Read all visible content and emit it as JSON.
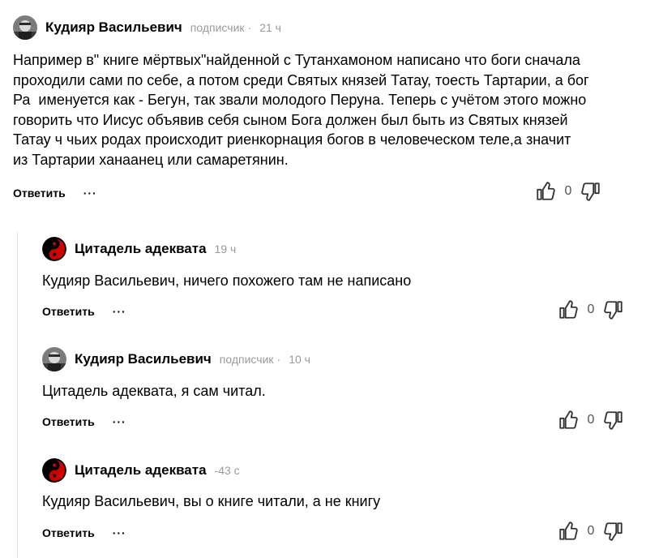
{
  "comments": [
    {
      "author": "Кудияр Васильевич",
      "badge": "подписчик",
      "dot": "·",
      "time": "21 ч",
      "text": "Например в\" книге мёртвых\"найденной с Тутанхамоном написано что боги сначала\nпроходили сами по себе, а потом среди Святых князей Татау, тоесть Тартарии, а бог\nРа  именуется как - Бегун, так звали молодого Перуна. Теперь с учётом этого можно\nговорить что Иисус объявив себя сыном Бога должен был быть из Святых князей\nТатау ч чьих родах происходит риенкорнация богов в человеческом теле,а значит\nиз Тартарии ханаанец или самаретянин.",
      "reply_label": "Ответить",
      "more_label": "···",
      "score": "0"
    },
    {
      "author": "Цитадель адеквата",
      "time": "19 ч",
      "text": "Кудияр Васильевич, ничего похожего там не написано",
      "reply_label": "Ответить",
      "more_label": "···",
      "score": "0"
    },
    {
      "author": "Кудияр Васильевич",
      "badge": "подписчик",
      "dot": "·",
      "time": "10 ч",
      "text": "Цитадель адеквата, я сам читал.",
      "reply_label": "Ответить",
      "more_label": "···",
      "score": "0"
    },
    {
      "author": "Цитадель адеквата",
      "time": "-43 с",
      "text": "Кудияр Васильевич, вы о книге читали, а не книгу",
      "reply_label": "Ответить",
      "more_label": "···",
      "score": "0"
    }
  ],
  "icons": {
    "like": "thumbs-up-icon",
    "dislike": "thumbs-down-icon",
    "avatar_kudiyar": "user-photo-avatar",
    "avatar_citadel": "yin-yang-avatar"
  },
  "colors": {
    "meta": "#9a9a9a",
    "thread_line": "#e2e2e2",
    "yin_yang_red": "#d00000"
  }
}
